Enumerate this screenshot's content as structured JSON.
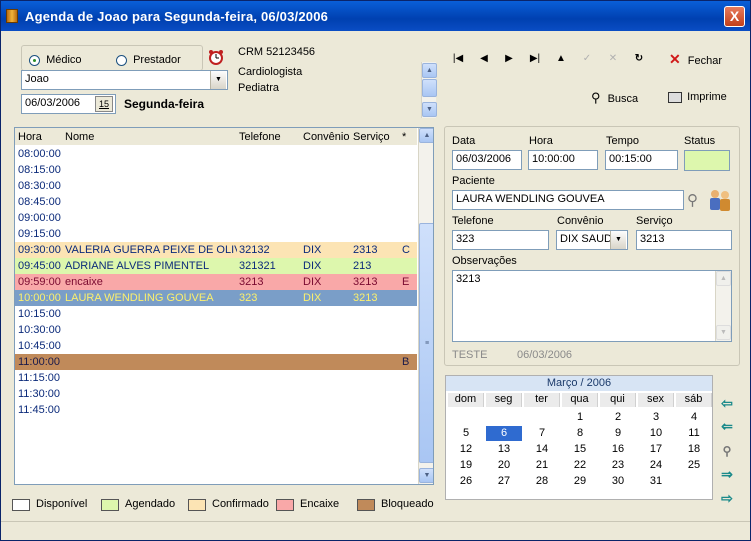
{
  "window": {
    "title": "Agenda de Joao para Segunda-feira, 06/03/2006",
    "close_label": "X"
  },
  "selector": {
    "medico_label": "Médico",
    "prestador_label": "Prestador",
    "professional_value": "Joao",
    "date_value": "06/03/2006",
    "calendar_btn": "15",
    "weekday": "Segunda-feira"
  },
  "info": {
    "lines": [
      "CRM 52123456",
      "Cardiologista",
      "Pediatra"
    ]
  },
  "toolbar": {
    "fechar": "Fechar",
    "busca": "Busca",
    "imprime": "Imprime"
  },
  "grid": {
    "headers": {
      "hora": "Hora",
      "nome": "Nome",
      "telefone": "Telefone",
      "convenio": "Convênio",
      "servico": "Serviço",
      "flag": "*"
    },
    "rows": [
      {
        "hora": "08:00:00",
        "nome": "",
        "telefone": "",
        "convenio": "",
        "servico": "",
        "flag": "",
        "status": "disponivel"
      },
      {
        "hora": "08:15:00",
        "nome": "",
        "telefone": "",
        "convenio": "",
        "servico": "",
        "flag": "",
        "status": "disponivel"
      },
      {
        "hora": "08:30:00",
        "nome": "",
        "telefone": "",
        "convenio": "",
        "servico": "",
        "flag": "",
        "status": "disponivel"
      },
      {
        "hora": "08:45:00",
        "nome": "",
        "telefone": "",
        "convenio": "",
        "servico": "",
        "flag": "",
        "status": "disponivel"
      },
      {
        "hora": "09:00:00",
        "nome": "",
        "telefone": "",
        "convenio": "",
        "servico": "",
        "flag": "",
        "status": "disponivel"
      },
      {
        "hora": "09:15:00",
        "nome": "",
        "telefone": "",
        "convenio": "",
        "servico": "",
        "flag": "",
        "status": "disponivel"
      },
      {
        "hora": "09:30:00",
        "nome": "VALERIA GUERRA PEIXE DE OLIV",
        "telefone": "32132",
        "convenio": "DIX",
        "servico": "2313",
        "flag": "C",
        "status": "confirmado"
      },
      {
        "hora": "09:45:00",
        "nome": "ADRIANE  ALVES PIMENTEL",
        "telefone": "321321",
        "convenio": "DIX",
        "servico": "213",
        "flag": "",
        "status": "agendado"
      },
      {
        "hora": "09:59:00",
        "nome": "encaixe",
        "telefone": "3213",
        "convenio": "DIX",
        "servico": "3213",
        "flag": "E",
        "status": "encaixe"
      },
      {
        "hora": "10:00:00",
        "nome": "LAURA WENDLING GOUVEA",
        "telefone": "323",
        "convenio": "DIX",
        "servico": "3213",
        "flag": "",
        "status": "selecionado"
      },
      {
        "hora": "10:15:00",
        "nome": "",
        "telefone": "",
        "convenio": "",
        "servico": "",
        "flag": "",
        "status": "disponivel"
      },
      {
        "hora": "10:30:00",
        "nome": "",
        "telefone": "",
        "convenio": "",
        "servico": "",
        "flag": "",
        "status": "disponivel"
      },
      {
        "hora": "10:45:00",
        "nome": "",
        "telefone": "",
        "convenio": "",
        "servico": "",
        "flag": "",
        "status": "disponivel"
      },
      {
        "hora": "11:00:00",
        "nome": "",
        "telefone": "",
        "convenio": "",
        "servico": "",
        "flag": "B",
        "status": "bloqueado"
      },
      {
        "hora": "11:15:00",
        "nome": "",
        "telefone": "",
        "convenio": "",
        "servico": "",
        "flag": "",
        "status": "disponivel"
      },
      {
        "hora": "11:30:00",
        "nome": "",
        "telefone": "",
        "convenio": "",
        "servico": "",
        "flag": "",
        "status": "disponivel"
      },
      {
        "hora": "11:45:00",
        "nome": "",
        "telefone": "",
        "convenio": "",
        "servico": "",
        "flag": "",
        "status": "disponivel"
      }
    ]
  },
  "status_colors": {
    "disponivel": "#ffffff",
    "agendado": "#ddf7ad",
    "confirmado": "#fce4b4",
    "encaixe": "#f9a8a8",
    "bloqueado": "#c08a5a",
    "selecionado": "#7a9ec8"
  },
  "legend": [
    "Disponível",
    "Agendado",
    "Confirmado",
    "Encaixe",
    "Bloqueado"
  ],
  "detail": {
    "data_label": "Data",
    "data_value": "06/03/2006",
    "hora_label": "Hora",
    "hora_value": "10:00:00",
    "tempo_label": "Tempo",
    "tempo_value": "00:15:00",
    "status_label": "Status",
    "status_color": "#ddf7ad",
    "paciente_label": "Paciente",
    "paciente_value": "LAURA WENDLING GOUVEA",
    "telefone_label": "Telefone",
    "telefone_value": "323",
    "convenio_label": "Convênio",
    "convenio_value": "DIX SAUD",
    "servico_label": "Serviço",
    "servico_value": "3213",
    "obs_label": "Observações",
    "obs_value": "3213",
    "footer_user": "TESTE",
    "footer_date": "06/03/2006"
  },
  "calendar": {
    "title": "Março / 2006",
    "dow": [
      "dom",
      "seg",
      "ter",
      "qua",
      "qui",
      "sex",
      "sáb"
    ],
    "selected_day": 6,
    "weeks": [
      [
        "",
        "",
        "",
        "1",
        "2",
        "3",
        "4"
      ],
      [
        "5",
        "6",
        "7",
        "8",
        "9",
        "10",
        "11"
      ],
      [
        "12",
        "13",
        "14",
        "15",
        "16",
        "17",
        "18"
      ],
      [
        "19",
        "20",
        "21",
        "22",
        "23",
        "24",
        "25"
      ],
      [
        "26",
        "27",
        "28",
        "29",
        "30",
        "31",
        ""
      ]
    ]
  }
}
